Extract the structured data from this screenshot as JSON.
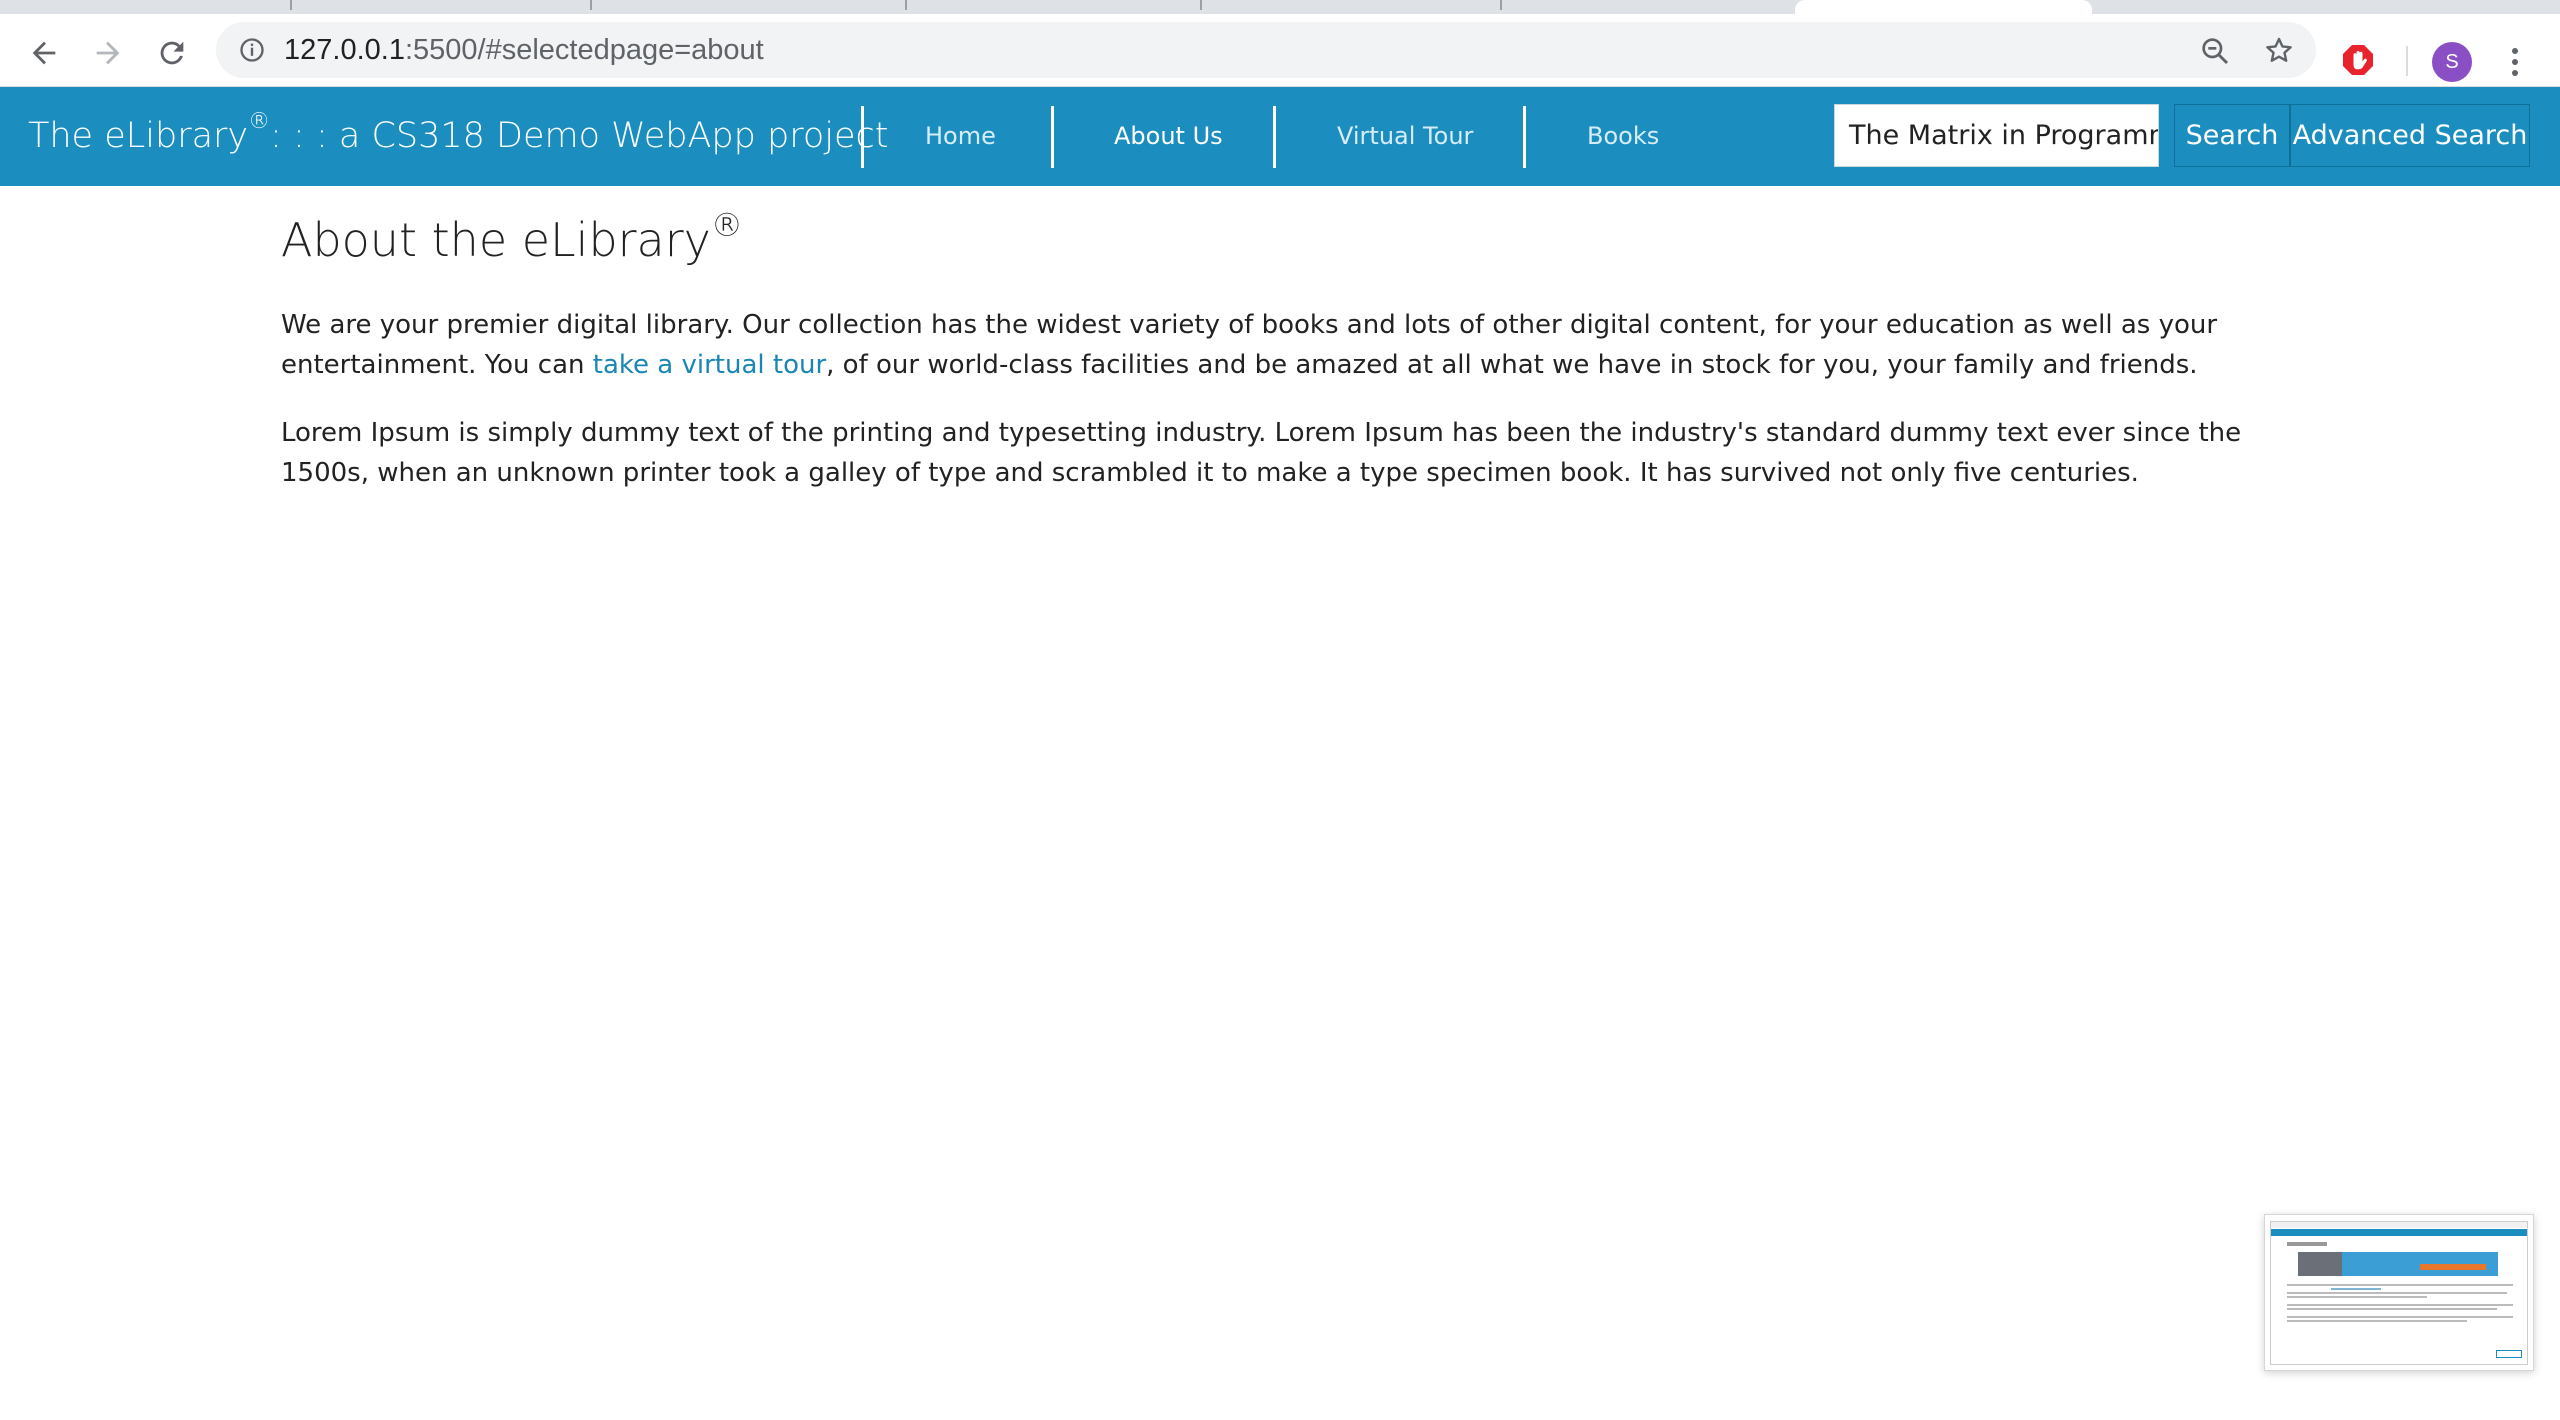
{
  "browser": {
    "url_host": "127.0.0.1",
    "url_path": ":5500/#selectedpage=about",
    "profile_initial": "S"
  },
  "navbar": {
    "brand_main": "The eLibrary",
    "brand_mark": "®",
    "brand_rest": ": : : a CS318 Demo WebApp project",
    "links": [
      "Home",
      "About Us",
      "Virtual Tour",
      "Books"
    ],
    "active_link": "About Us",
    "search_value": "The Matrix in Programm",
    "search_button": "Search",
    "advanced_search_button": "Advanced Search"
  },
  "page": {
    "title_main": "About the eLibrary",
    "title_mark": "®",
    "p1_before_link": "We are your premier digital library. Our collection has the widest variety of books and lots of other digital content, for your education as well as your entertainment. You can ",
    "p1_link": "take a virtual tour",
    "p1_after_link": ", of our world-class facilities and be amazed at all what we have in stock for you, your family and friends.",
    "p2": "Lorem Ipsum is simply dummy text of the printing and typesetting industry. Lorem Ipsum has been the industry's standard dummy text ever since the 1500s, when an unknown printer took a galley of type and scrambled it to make a type specimen book. It has survived not only five centuries."
  },
  "colors": {
    "navbar_bg": "#1b8ebf",
    "link": "#1a86b5",
    "avatar": "#8a4fc4"
  },
  "icons": {
    "back": "arrow-left-icon",
    "forward": "arrow-right-icon",
    "reload": "reload-icon",
    "info": "info-icon",
    "zoom": "zoom-out-icon",
    "bookmark": "star-icon",
    "extension": "hand-stop-icon",
    "menu": "kebab-menu-icon"
  }
}
